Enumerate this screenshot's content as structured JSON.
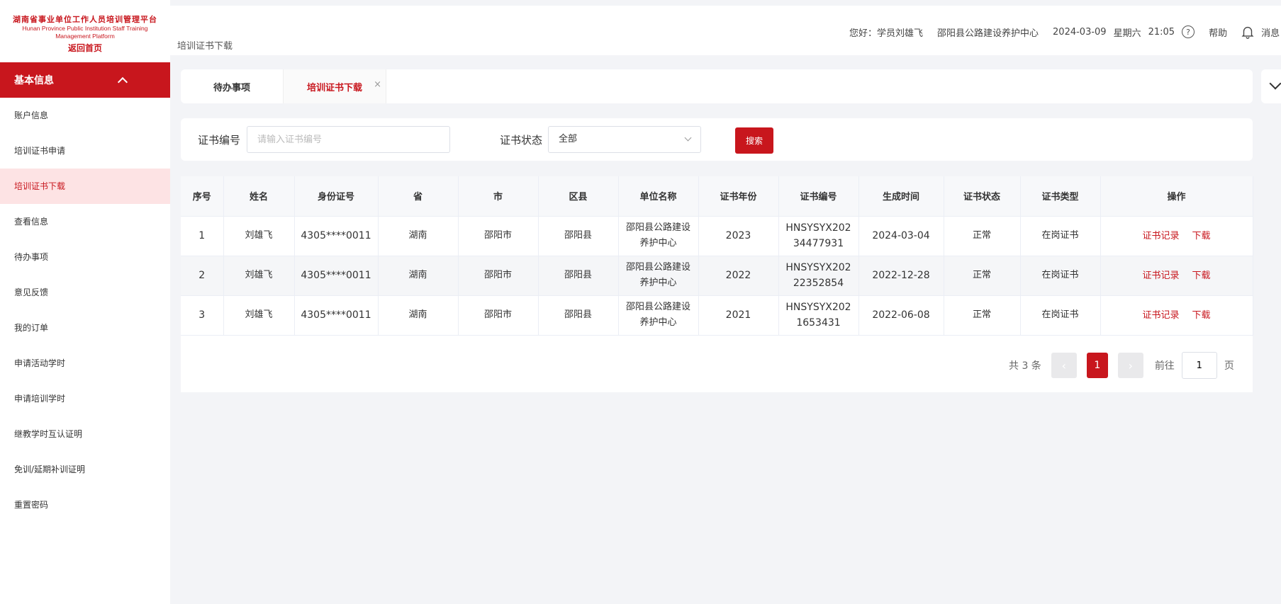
{
  "logo": {
    "cn": "湖南省事业单位工作人员培训管理平台",
    "en_line1": "Hunan Province Public Institution Staff Training",
    "en_line2": "Management Platform",
    "back": "返回首页"
  },
  "sidebar": {
    "section": "基本信息",
    "items": [
      {
        "label": "账户信息"
      },
      {
        "label": "培训证书申请"
      },
      {
        "label": "培训证书下载"
      },
      {
        "label": "查看信息"
      },
      {
        "label": "待办事项"
      },
      {
        "label": "意见反馈"
      },
      {
        "label": "我的订单"
      },
      {
        "label": "申请活动学时"
      },
      {
        "label": "申请培训学时"
      },
      {
        "label": "继教学时互认证明"
      },
      {
        "label": "免训/延期补训证明"
      },
      {
        "label": "重置密码"
      }
    ]
  },
  "header": {
    "breadcrumb": "培训证书下载",
    "greeting": "您好：学员刘雄飞",
    "org": "邵阳县公路建设养护中心",
    "date": "2024-03-09",
    "weekday": "星期六",
    "time": "21:05",
    "help": "帮助",
    "msg": "消息"
  },
  "tabs": [
    {
      "label": "待办事项"
    },
    {
      "label": "培训证书下载",
      "close": "×"
    }
  ],
  "search": {
    "cert_no_label": "证书编号",
    "cert_no_placeholder": "请输入证书编号",
    "status_label": "证书状态",
    "status_value": "全部",
    "button": "搜索"
  },
  "table": {
    "headers": [
      "序号",
      "姓名",
      "身份证号",
      "省",
      "市",
      "区县",
      "单位名称",
      "证书年份",
      "证书编号",
      "生成时间",
      "证书状态",
      "证书类型",
      "操作"
    ],
    "rows": [
      {
        "no": "1",
        "name": "刘雄飞",
        "id": "4305****0011",
        "prov": "湖南",
        "city": "邵阳市",
        "county": "邵阳县",
        "unit": "邵阳县公路建设养护中心",
        "year": "2023",
        "cert": "HNSYSYX20234477931",
        "created": "2024-03-04",
        "status": "正常",
        "type": "在岗证书",
        "op1": "证书记录",
        "op2": "下载"
      },
      {
        "no": "2",
        "name": "刘雄飞",
        "id": "4305****0011",
        "prov": "湖南",
        "city": "邵阳市",
        "county": "邵阳县",
        "unit": "邵阳县公路建设养护中心",
        "year": "2022",
        "cert": "HNSYSYX20222352854",
        "created": "2022-12-28",
        "status": "正常",
        "type": "在岗证书",
        "op1": "证书记录",
        "op2": "下载"
      },
      {
        "no": "3",
        "name": "刘雄飞",
        "id": "4305****0011",
        "prov": "湖南",
        "city": "邵阳市",
        "county": "邵阳县",
        "unit": "邵阳县公路建设养护中心",
        "year": "2021",
        "cert": "HNSYSYX2021653431",
        "created": "2022-06-08",
        "status": "正常",
        "type": "在岗证书",
        "op1": "证书记录",
        "op2": "下载"
      }
    ]
  },
  "pager": {
    "total": "共 3 条",
    "prev": "‹",
    "page": "1",
    "next": "›",
    "goto": "前往",
    "goto_value": "1",
    "unit": "页"
  },
  "colors": {
    "accent": "#c8161d",
    "active_bg": "#fde3e4"
  }
}
